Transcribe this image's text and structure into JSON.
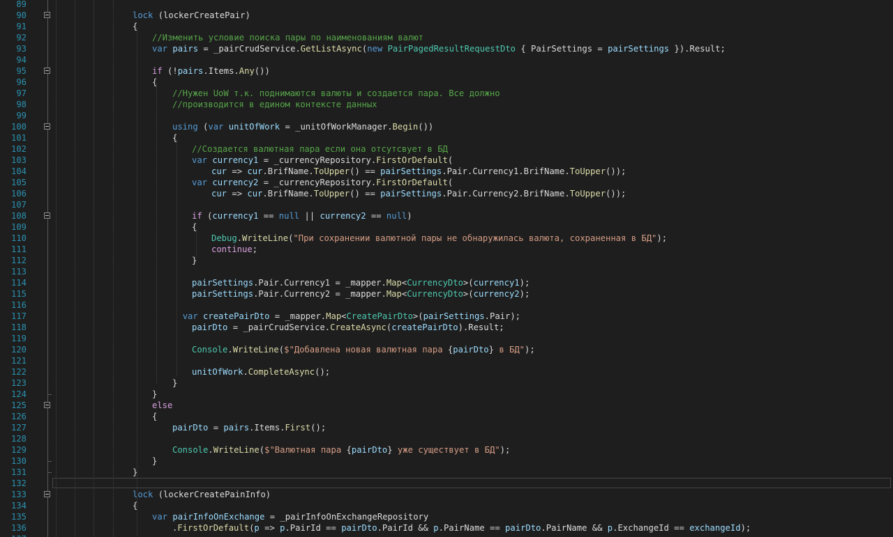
{
  "editor": {
    "theme_colors": {
      "background": "#1e1e1e",
      "line_number": "#2b91af",
      "keyword": "#569cd6",
      "control_keyword": "#d8a0df",
      "type": "#4ec9b0",
      "method": "#dcdcaa",
      "variable": "#9cdcfe",
      "comment": "#57a64a",
      "string": "#d69d85"
    },
    "current_line": 132,
    "lines": [
      {
        "n": "89",
        "indent": 0,
        "tokens": []
      },
      {
        "n": "90",
        "indent": 6,
        "tokens": [
          [
            "k",
            "lock"
          ],
          [
            "p",
            " ("
          ],
          [
            "p",
            "lockerCreatePair"
          ],
          [
            "p",
            ")"
          ]
        ]
      },
      {
        "n": "91",
        "indent": 6,
        "tokens": [
          [
            "p",
            "{"
          ]
        ]
      },
      {
        "n": "92",
        "indent": 7,
        "tokens": [
          [
            "c",
            "//Изменить условие поиска пары по наименованиям валют"
          ]
        ]
      },
      {
        "n": "93",
        "indent": 7,
        "tokens": [
          [
            "k",
            "var"
          ],
          [
            "p",
            " "
          ],
          [
            "v",
            "pairs"
          ],
          [
            "p",
            " = _pairCrudService."
          ],
          [
            "m",
            "GetListAsync"
          ],
          [
            "p",
            "("
          ],
          [
            "k",
            "new"
          ],
          [
            "p",
            " "
          ],
          [
            "t",
            "PairPagedResultRequestDto"
          ],
          [
            "p",
            " { PairSettings = "
          ],
          [
            "v",
            "pairSettings"
          ],
          [
            "p",
            " }).Result;"
          ]
        ]
      },
      {
        "n": "94",
        "indent": 0,
        "tokens": []
      },
      {
        "n": "95",
        "indent": 7,
        "tokens": [
          [
            "kc",
            "if"
          ],
          [
            "p",
            " (!"
          ],
          [
            "v",
            "pairs"
          ],
          [
            "p",
            ".Items."
          ],
          [
            "m",
            "Any"
          ],
          [
            "p",
            "())"
          ]
        ]
      },
      {
        "n": "96",
        "indent": 7,
        "tokens": [
          [
            "p",
            "{"
          ]
        ]
      },
      {
        "n": "97",
        "indent": 8,
        "tokens": [
          [
            "c",
            "//Нужен UoW т.к. поднимаются валюты и создается пара. Все должно"
          ]
        ]
      },
      {
        "n": "98",
        "indent": 8,
        "tokens": [
          [
            "c",
            "//производится в едином контексте данных"
          ]
        ]
      },
      {
        "n": "99",
        "indent": 0,
        "tokens": []
      },
      {
        "n": "100",
        "indent": 8,
        "tokens": [
          [
            "k",
            "using"
          ],
          [
            "p",
            " ("
          ],
          [
            "k",
            "var"
          ],
          [
            "p",
            " "
          ],
          [
            "v",
            "unitOfWork"
          ],
          [
            "p",
            " = _unitOfWorkManager."
          ],
          [
            "m",
            "Begin"
          ],
          [
            "p",
            "())"
          ]
        ]
      },
      {
        "n": "101",
        "indent": 8,
        "tokens": [
          [
            "p",
            "{"
          ]
        ]
      },
      {
        "n": "102",
        "indent": 9,
        "tokens": [
          [
            "c",
            "//Создается валютная пара если она отсутсвует в БД"
          ]
        ]
      },
      {
        "n": "103",
        "indent": 9,
        "tokens": [
          [
            "k",
            "var"
          ],
          [
            "p",
            " "
          ],
          [
            "v",
            "currency1"
          ],
          [
            "p",
            " = _currencyRepository."
          ],
          [
            "m",
            "FirstOrDefault"
          ],
          [
            "p",
            "("
          ]
        ]
      },
      {
        "n": "104",
        "indent": 10,
        "tokens": [
          [
            "v",
            "cur"
          ],
          [
            "p",
            " => "
          ],
          [
            "v",
            "cur"
          ],
          [
            "p",
            ".BrifName."
          ],
          [
            "m",
            "ToUpper"
          ],
          [
            "p",
            "() == "
          ],
          [
            "v",
            "pairSettings"
          ],
          [
            "p",
            ".Pair.Currency1.BrifName."
          ],
          [
            "m",
            "ToUpper"
          ],
          [
            "p",
            "());"
          ]
        ]
      },
      {
        "n": "105",
        "indent": 9,
        "tokens": [
          [
            "k",
            "var"
          ],
          [
            "p",
            " "
          ],
          [
            "v",
            "currency2"
          ],
          [
            "p",
            " = _currencyRepository."
          ],
          [
            "m",
            "FirstOrDefault"
          ],
          [
            "p",
            "("
          ]
        ]
      },
      {
        "n": "106",
        "indent": 10,
        "tokens": [
          [
            "v",
            "cur"
          ],
          [
            "p",
            " => "
          ],
          [
            "v",
            "cur"
          ],
          [
            "p",
            ".BrifName."
          ],
          [
            "m",
            "ToUpper"
          ],
          [
            "p",
            "() == "
          ],
          [
            "v",
            "pairSettings"
          ],
          [
            "p",
            ".Pair.Currency2.BrifName."
          ],
          [
            "m",
            "ToUpper"
          ],
          [
            "p",
            "());"
          ]
        ]
      },
      {
        "n": "107",
        "indent": 0,
        "tokens": []
      },
      {
        "n": "108",
        "indent": 9,
        "tokens": [
          [
            "kc",
            "if"
          ],
          [
            "p",
            " ("
          ],
          [
            "v",
            "currency1"
          ],
          [
            "p",
            " == "
          ],
          [
            "k",
            "null"
          ],
          [
            "p",
            " || "
          ],
          [
            "v",
            "currency2"
          ],
          [
            "p",
            " == "
          ],
          [
            "k",
            "null"
          ],
          [
            "p",
            ")"
          ]
        ]
      },
      {
        "n": "109",
        "indent": 9,
        "tokens": [
          [
            "p",
            "{"
          ]
        ]
      },
      {
        "n": "110",
        "indent": 10,
        "tokens": [
          [
            "t",
            "Debug"
          ],
          [
            "p",
            "."
          ],
          [
            "m",
            "WriteLine"
          ],
          [
            "p",
            "("
          ],
          [
            "s",
            "\"При сохранении валютной пары не обнаружилась валюта, сохраненная в БД\""
          ],
          [
            "p",
            ");"
          ]
        ]
      },
      {
        "n": "111",
        "indent": 10,
        "tokens": [
          [
            "kc",
            "continue"
          ],
          [
            "p",
            ";"
          ]
        ]
      },
      {
        "n": "112",
        "indent": 9,
        "tokens": [
          [
            "p",
            "}"
          ]
        ]
      },
      {
        "n": "113",
        "indent": 0,
        "tokens": []
      },
      {
        "n": "114",
        "indent": 9,
        "tokens": [
          [
            "v",
            "pairSettings"
          ],
          [
            "p",
            ".Pair.Currency1 = _mapper."
          ],
          [
            "m",
            "Map"
          ],
          [
            "p",
            "<"
          ],
          [
            "t",
            "CurrencyDto"
          ],
          [
            "p",
            ">("
          ],
          [
            "v",
            "currency1"
          ],
          [
            "p",
            ");"
          ]
        ]
      },
      {
        "n": "115",
        "indent": 9,
        "tokens": [
          [
            "v",
            "pairSettings"
          ],
          [
            "p",
            ".Pair.Currency2 = _mapper."
          ],
          [
            "m",
            "Map"
          ],
          [
            "p",
            "<"
          ],
          [
            "t",
            "CurrencyDto"
          ],
          [
            "p",
            ">("
          ],
          [
            "v",
            "currency2"
          ],
          [
            "p",
            ");"
          ]
        ]
      },
      {
        "n": "116",
        "indent": 0,
        "tokens": []
      },
      {
        "n": "117",
        "indent": 8,
        "tokens": [
          [
            "p",
            "  "
          ],
          [
            "k",
            "var"
          ],
          [
            "p",
            " "
          ],
          [
            "v",
            "createPairDto"
          ],
          [
            "p",
            " = _mapper."
          ],
          [
            "m",
            "Map"
          ],
          [
            "p",
            "<"
          ],
          [
            "t",
            "CreatePairDto"
          ],
          [
            "p",
            ">("
          ],
          [
            "v",
            "pairSettings"
          ],
          [
            "p",
            ".Pair);"
          ]
        ]
      },
      {
        "n": "118",
        "indent": 9,
        "tokens": [
          [
            "v",
            "pairDto"
          ],
          [
            "p",
            " = _pairCrudService."
          ],
          [
            "m",
            "CreateAsync"
          ],
          [
            "p",
            "("
          ],
          [
            "v",
            "createPairDto"
          ],
          [
            "p",
            ").Result;"
          ]
        ]
      },
      {
        "n": "119",
        "indent": 0,
        "tokens": []
      },
      {
        "n": "120",
        "indent": 9,
        "tokens": [
          [
            "t",
            "Console"
          ],
          [
            "p",
            "."
          ],
          [
            "m",
            "WriteLine"
          ],
          [
            "p",
            "("
          ],
          [
            "s",
            "$\"Добавлена новая валютная пара "
          ],
          [
            "p",
            "{"
          ],
          [
            "v",
            "pairDto"
          ],
          [
            "p",
            "}"
          ],
          [
            "s",
            " в БД\""
          ],
          [
            "p",
            ");"
          ]
        ]
      },
      {
        "n": "121",
        "indent": 0,
        "tokens": []
      },
      {
        "n": "122",
        "indent": 9,
        "tokens": [
          [
            "v",
            "unitOfWork"
          ],
          [
            "p",
            "."
          ],
          [
            "m",
            "CompleteAsync"
          ],
          [
            "p",
            "();"
          ]
        ]
      },
      {
        "n": "123",
        "indent": 8,
        "tokens": [
          [
            "p",
            "}"
          ]
        ]
      },
      {
        "n": "124",
        "indent": 7,
        "tokens": [
          [
            "p",
            "}"
          ]
        ]
      },
      {
        "n": "125",
        "indent": 7,
        "tokens": [
          [
            "kc",
            "else"
          ]
        ]
      },
      {
        "n": "126",
        "indent": 7,
        "tokens": [
          [
            "p",
            "{"
          ]
        ]
      },
      {
        "n": "127",
        "indent": 8,
        "tokens": [
          [
            "v",
            "pairDto"
          ],
          [
            "p",
            " = "
          ],
          [
            "v",
            "pairs"
          ],
          [
            "p",
            ".Items."
          ],
          [
            "m",
            "First"
          ],
          [
            "p",
            "();"
          ]
        ]
      },
      {
        "n": "128",
        "indent": 0,
        "tokens": []
      },
      {
        "n": "129",
        "indent": 8,
        "tokens": [
          [
            "t",
            "Console"
          ],
          [
            "p",
            "."
          ],
          [
            "m",
            "WriteLine"
          ],
          [
            "p",
            "("
          ],
          [
            "s",
            "$\"Валютная пара "
          ],
          [
            "p",
            "{"
          ],
          [
            "v",
            "pairDto"
          ],
          [
            "p",
            "}"
          ],
          [
            "s",
            " уже существует в БД\""
          ],
          [
            "p",
            ");"
          ]
        ]
      },
      {
        "n": "130",
        "indent": 7,
        "tokens": [
          [
            "p",
            "}"
          ]
        ]
      },
      {
        "n": "131",
        "indent": 6,
        "tokens": [
          [
            "p",
            "}"
          ]
        ]
      },
      {
        "n": "132",
        "indent": 0,
        "tokens": []
      },
      {
        "n": "133",
        "indent": 6,
        "tokens": [
          [
            "k",
            "lock"
          ],
          [
            "p",
            " ("
          ],
          [
            "p",
            "lockerCreatePainInfo"
          ],
          [
            "p",
            ")"
          ]
        ]
      },
      {
        "n": "134",
        "indent": 6,
        "tokens": [
          [
            "p",
            "{"
          ]
        ]
      },
      {
        "n": "135",
        "indent": 7,
        "tokens": [
          [
            "k",
            "var"
          ],
          [
            "p",
            " "
          ],
          [
            "v",
            "pairInfoOnExchange"
          ],
          [
            "p",
            " = _pairInfoOnExchangeRepository"
          ]
        ]
      },
      {
        "n": "136",
        "indent": 8,
        "tokens": [
          [
            "p",
            "."
          ],
          [
            "m",
            "FirstOrDefault"
          ],
          [
            "p",
            "("
          ],
          [
            "v",
            "p"
          ],
          [
            "p",
            " => "
          ],
          [
            "v",
            "p"
          ],
          [
            "p",
            ".PairId == "
          ],
          [
            "v",
            "pairDto"
          ],
          [
            "p",
            ".PairId && "
          ],
          [
            "v",
            "p"
          ],
          [
            "p",
            ".PairName == "
          ],
          [
            "v",
            "pairDto"
          ],
          [
            "p",
            ".PairName && "
          ],
          [
            "v",
            "p"
          ],
          [
            "p",
            ".ExchangeId == "
          ],
          [
            "v",
            "exchangeId"
          ],
          [
            "p",
            ");"
          ]
        ]
      },
      {
        "n": "137",
        "indent": 0,
        "tokens": []
      }
    ]
  }
}
